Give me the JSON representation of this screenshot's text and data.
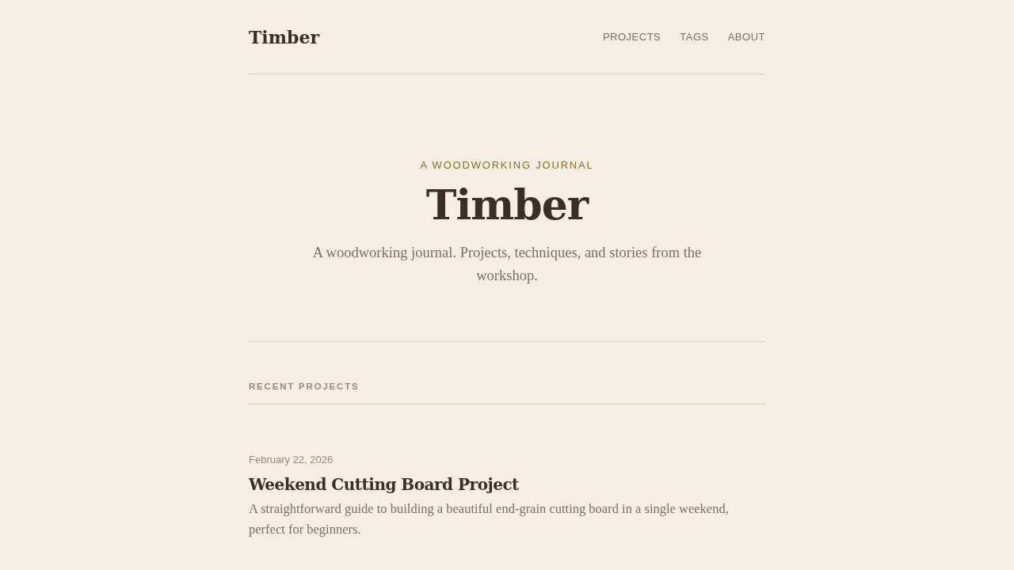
{
  "header": {
    "logo": "Timber",
    "nav": [
      {
        "label": "PROJECTS"
      },
      {
        "label": "TAGS"
      },
      {
        "label": "ABOUT"
      }
    ]
  },
  "hero": {
    "eyebrow": "A WOODWORKING JOURNAL",
    "title": "Timber",
    "subtitle": "A woodworking journal. Projects, techniques, and stories from the workshop."
  },
  "section": {
    "label": "RECENT PROJECTS"
  },
  "posts": [
    {
      "date": "February 22, 2026",
      "title": "Weekend Cutting Board Project",
      "excerpt": "A straightforward guide to building a beautiful end-grain cutting board in a single weekend, perfect for beginners."
    }
  ]
}
